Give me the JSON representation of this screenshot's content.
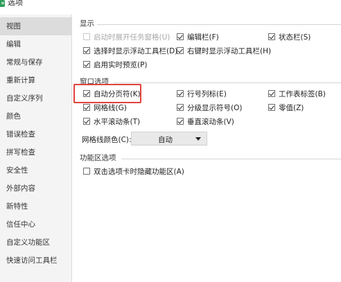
{
  "window": {
    "title": "选项"
  },
  "sidebar": {
    "items": [
      {
        "label": "视图",
        "active": true
      },
      {
        "label": "编辑"
      },
      {
        "label": "常规与保存"
      },
      {
        "label": "重新计算"
      },
      {
        "label": "自定义序列"
      },
      {
        "label": "颜色"
      },
      {
        "label": "错误检查"
      },
      {
        "label": "拼写检查"
      },
      {
        "label": "安全性"
      },
      {
        "label": "外部内容"
      },
      {
        "label": "新特性"
      },
      {
        "label": "信任中心"
      },
      {
        "label": "自定义功能区"
      },
      {
        "label": "快速访问工具栏"
      }
    ]
  },
  "display": {
    "title": "显示",
    "options": [
      {
        "label": "启动时展开任务窗格(U)",
        "checked": false,
        "disabled": true
      },
      {
        "label": "编辑栏(F)",
        "checked": true
      },
      {
        "label": "状态栏(S)",
        "checked": true
      },
      {
        "label": "选择时显示浮动工具栏(D)",
        "checked": true
      },
      {
        "label": "右键时显示浮动工具栏(H)",
        "checked": true
      },
      {
        "label": "启用实时预览(P)",
        "checked": true
      }
    ]
  },
  "window_options": {
    "title": "窗口选项",
    "options": [
      {
        "label": "自动分页符(K)",
        "checked": true
      },
      {
        "label": "行号列标(E)",
        "checked": true
      },
      {
        "label": "工作表标签(B)",
        "checked": true
      },
      {
        "label": "网格线(G)",
        "checked": true
      },
      {
        "label": "分级显示符号(O)",
        "checked": true
      },
      {
        "label": "零值(Z)",
        "checked": true
      },
      {
        "label": "水平滚动条(T)",
        "checked": true
      },
      {
        "label": "垂直滚动条(V)",
        "checked": true
      }
    ],
    "gridline_color_label": "网格线颜色(C):",
    "gridline_color_value": "自动"
  },
  "ribbon_options": {
    "title": "功能区选项",
    "options": [
      {
        "label": "双击选项卡时隐藏功能区(A)",
        "checked": false
      }
    ]
  },
  "colors": {
    "highlight": "#e0413b",
    "app_icon": "#2e9e5b"
  }
}
